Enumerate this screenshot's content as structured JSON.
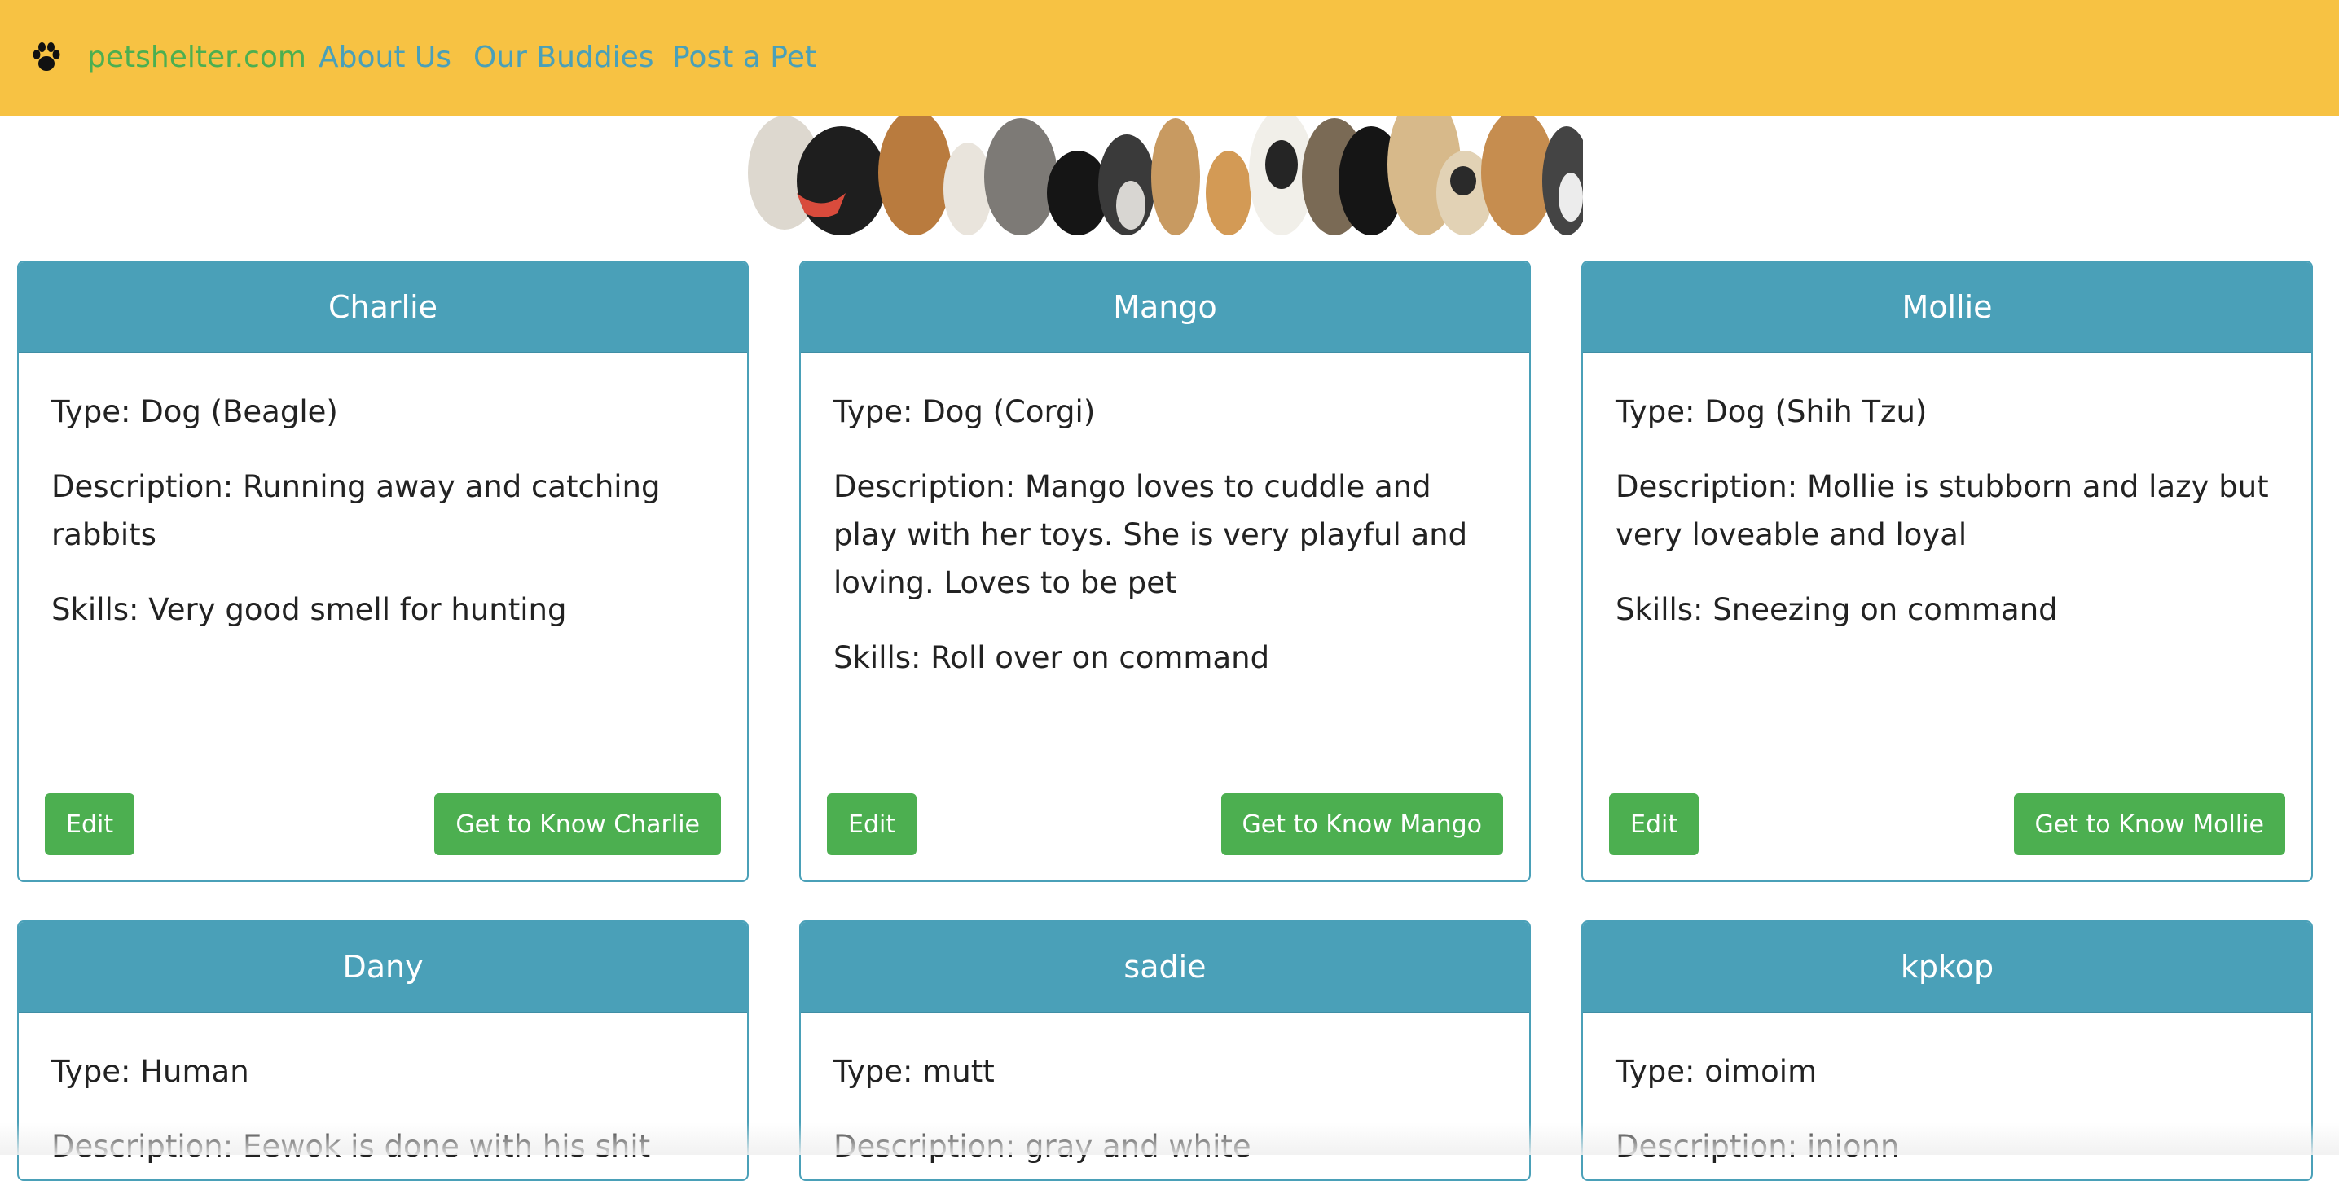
{
  "nav": {
    "brand": "petshelter.com",
    "links": [
      "About Us",
      "Our Buddies",
      "Post a Pet"
    ]
  },
  "banner": {
    "alt": "row of dogs"
  },
  "pets": [
    {
      "name": "Charlie",
      "type": "Type: Dog (Beagle)",
      "description": "Description: Running away and catching rabbits",
      "skills": "Skills: Very good smell for hunting",
      "edit": "Edit",
      "know": "Get to Know Charlie"
    },
    {
      "name": "Mango",
      "type": "Type: Dog (Corgi)",
      "description": "Description: Mango loves to cuddle and play with her toys. She is very playful and loving. Loves to be pet",
      "skills": "Skills: Roll over on command",
      "edit": "Edit",
      "know": "Get to Know Mango"
    },
    {
      "name": "Mollie",
      "type": "Type: Dog (Shih Tzu)",
      "description": "Description: Mollie is stubborn and lazy but very loveable and loyal",
      "skills": "Skills: Sneezing on command",
      "edit": "Edit",
      "know": "Get to Know Mollie"
    },
    {
      "name": "Dany",
      "type": "Type: Human",
      "description": "Description: Eewok is done with his shit"
    },
    {
      "name": "sadie",
      "type": "Type: mutt",
      "description": "Description: gray and white"
    },
    {
      "name": "kpkop",
      "type": "Type: oimoim",
      "description": "Description: inionn"
    }
  ],
  "colors": {
    "navbar": "#f7c243",
    "brand": "#4caf50",
    "navlink": "#4aa0b8",
    "card_header": "#4aa0b8",
    "button": "#4caf50"
  }
}
